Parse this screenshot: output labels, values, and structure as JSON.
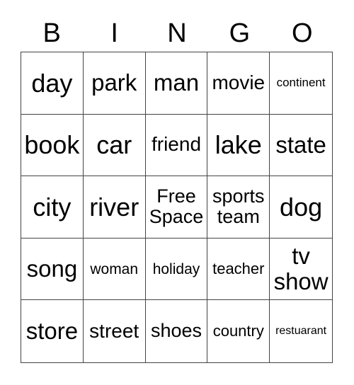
{
  "header": [
    "B",
    "I",
    "N",
    "G",
    "O"
  ],
  "cells": [
    [
      "day",
      "park",
      "man",
      "movie",
      "continent"
    ],
    [
      "book",
      "car",
      "friend",
      "lake",
      "state"
    ],
    [
      "city",
      "river",
      "Free Space",
      "sports team",
      "dog"
    ],
    [
      "song",
      "woman",
      "holiday",
      "teacher",
      "tv show"
    ],
    [
      "store",
      "street",
      "shoes",
      "country",
      "restuarant"
    ]
  ]
}
